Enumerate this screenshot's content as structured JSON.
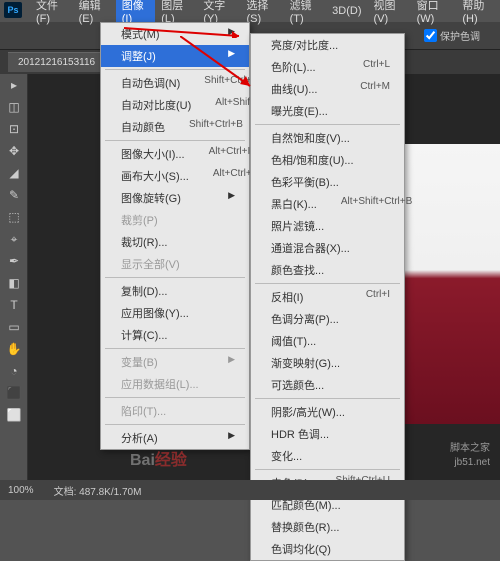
{
  "app": {
    "ps": "Ps"
  },
  "menubar": [
    "文件(F)",
    "编辑(E)",
    "图像(I)",
    "图层(L)",
    "文字(Y)",
    "选择(S)",
    "滤镜(T)",
    "3D(D)",
    "视图(V)",
    "窗口(W)",
    "帮助(H)"
  ],
  "toolbar": {
    "protect": "保护色调"
  },
  "tab": {
    "name": "20121216153116"
  },
  "tools": [
    "▸",
    "◫",
    "⊡",
    "✥",
    "◢",
    "✎",
    "⬚",
    "⌖",
    "✒",
    "◧",
    "T",
    "▭",
    "✋",
    "◔",
    "⬛",
    "⬜"
  ],
  "menu1": {
    "items": [
      {
        "label": "模式(M)",
        "arrow": true
      },
      {
        "label": "调整(J)",
        "arrow": true,
        "hl": true
      },
      {
        "sep": true
      },
      {
        "label": "自动色调(N)",
        "sc": "Shift+Ctrl+L"
      },
      {
        "label": "自动对比度(U)",
        "sc": "Alt+Shift+Ctrl+L"
      },
      {
        "label": "自动颜色",
        "sc": "Shift+Ctrl+B"
      },
      {
        "sep": true
      },
      {
        "label": "图像大小(I)...",
        "sc": "Alt+Ctrl+I"
      },
      {
        "label": "画布大小(S)...",
        "sc": "Alt+Ctrl+C"
      },
      {
        "label": "图像旋转(G)",
        "arrow": true
      },
      {
        "label": "裁剪(P)",
        "disabled": true
      },
      {
        "label": "裁切(R)..."
      },
      {
        "label": "显示全部(V)",
        "disabled": true
      },
      {
        "sep": true
      },
      {
        "label": "复制(D)..."
      },
      {
        "label": "应用图像(Y)..."
      },
      {
        "label": "计算(C)..."
      },
      {
        "sep": true
      },
      {
        "label": "变量(B)",
        "arrow": true,
        "disabled": true
      },
      {
        "label": "应用数据组(L)...",
        "disabled": true
      },
      {
        "sep": true
      },
      {
        "label": "陷印(T)...",
        "disabled": true
      },
      {
        "sep": true
      },
      {
        "label": "分析(A)",
        "arrow": true
      }
    ]
  },
  "menu2": {
    "items": [
      {
        "label": "亮度/对比度..."
      },
      {
        "label": "色阶(L)...",
        "sc": "Ctrl+L"
      },
      {
        "label": "曲线(U)...",
        "sc": "Ctrl+M"
      },
      {
        "label": "曝光度(E)..."
      },
      {
        "sep": true
      },
      {
        "label": "自然饱和度(V)..."
      },
      {
        "label": "色相/饱和度(U)..."
      },
      {
        "label": "色彩平衡(B)..."
      },
      {
        "label": "黑白(K)...",
        "sc": "Alt+Shift+Ctrl+B"
      },
      {
        "label": "照片滤镜..."
      },
      {
        "label": "通道混合器(X)..."
      },
      {
        "label": "颜色查找..."
      },
      {
        "sep": true
      },
      {
        "label": "反相(I)",
        "sc": "Ctrl+I"
      },
      {
        "label": "色调分离(P)..."
      },
      {
        "label": "阈值(T)..."
      },
      {
        "label": "渐变映射(G)..."
      },
      {
        "label": "可选颜色..."
      },
      {
        "sep": true
      },
      {
        "label": "阴影/高光(W)..."
      },
      {
        "label": "HDR 色调..."
      },
      {
        "label": "变化..."
      },
      {
        "sep": true
      },
      {
        "label": "去色(D)",
        "sc": "Shift+Ctrl+U"
      },
      {
        "label": "匹配颜色(M)..."
      },
      {
        "label": "替换颜色(R)..."
      },
      {
        "label": "色调均化(Q)"
      }
    ]
  },
  "status": {
    "zoom": "100%",
    "doc": "文档: 487.8K/1.70M"
  },
  "watermark": {
    "site": "脚本之家",
    "url": "jb51.net",
    "baidu": "Bai",
    "baidu2": "经验"
  }
}
